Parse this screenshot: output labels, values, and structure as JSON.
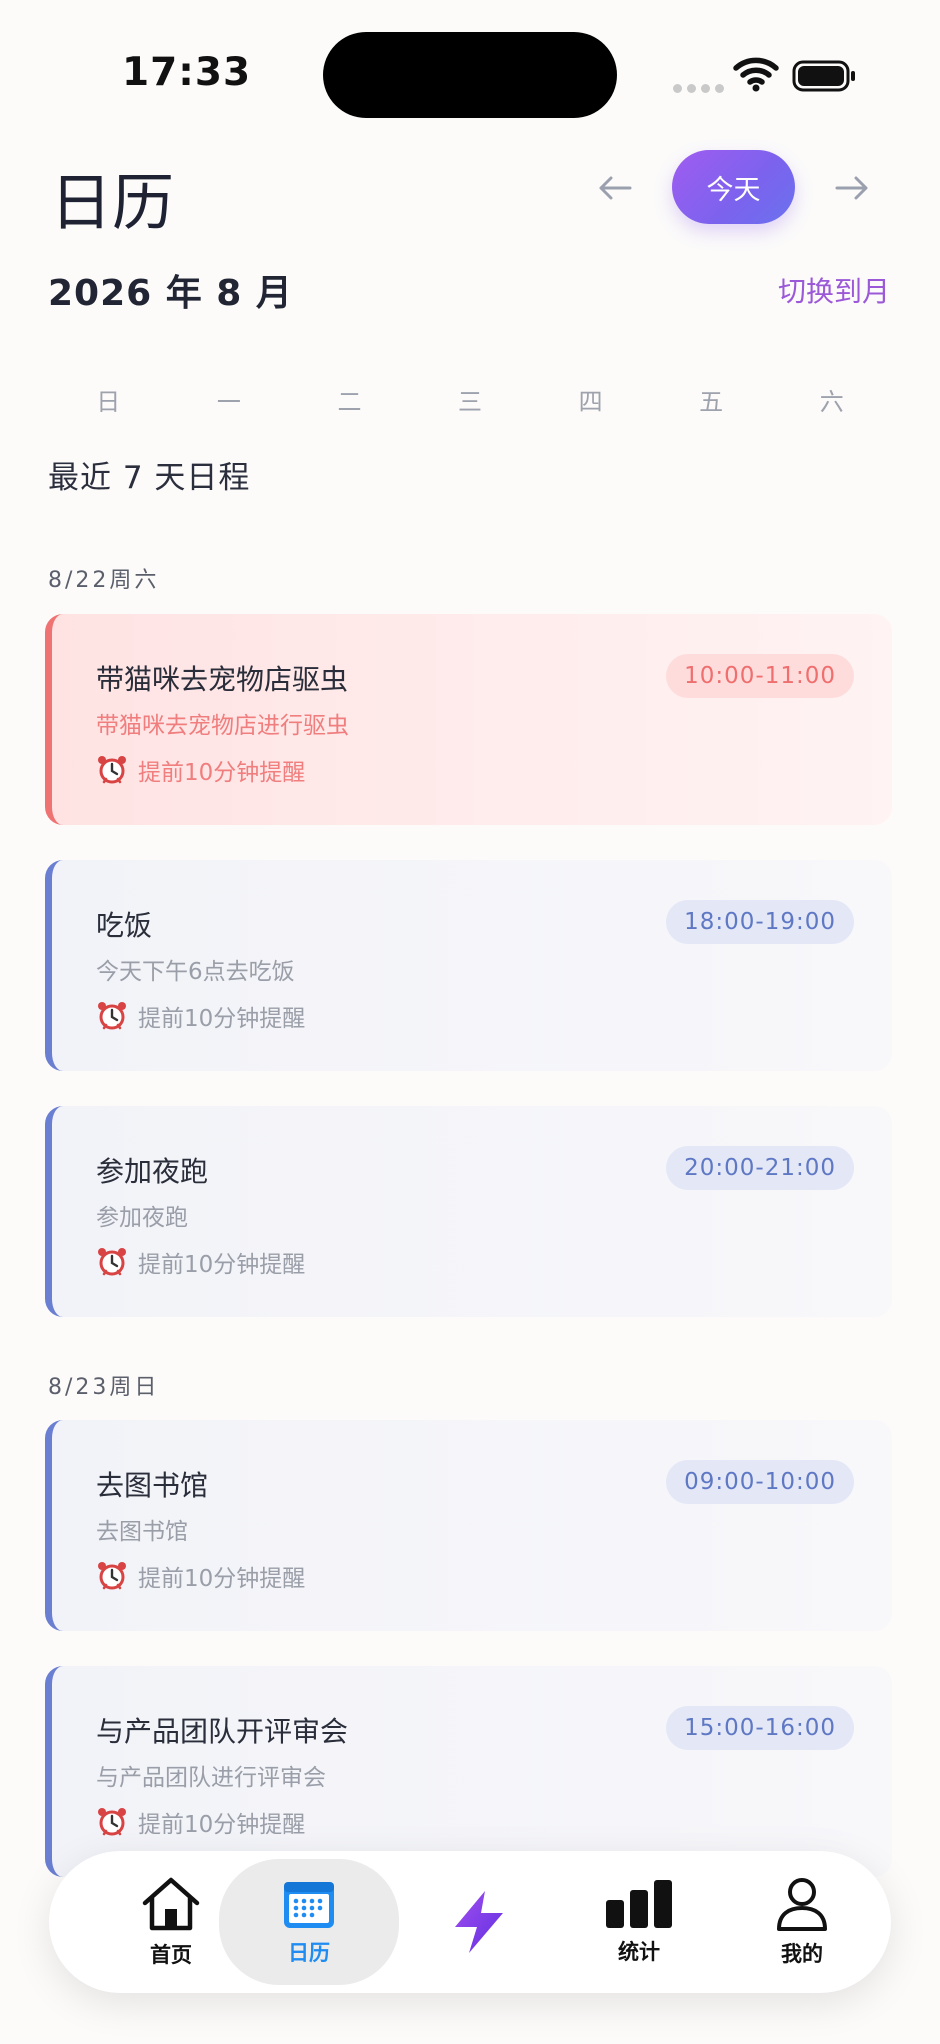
{
  "status_bar": {
    "time": "17:33"
  },
  "header": {
    "title": "日历",
    "today_label": "今天",
    "month_label": "2026 年 8 月",
    "switch_label": "切换到月"
  },
  "weekdays": [
    "日",
    "一",
    "二",
    "三",
    "四",
    "五",
    "六"
  ],
  "section_title": "最近 7 天日程",
  "days": [
    {
      "label": "8/22周六",
      "events": [
        {
          "title": "带猫咪去宠物店驱虫",
          "desc": "带猫咪去宠物店进行驱虫",
          "reminder": "提前10分钟提醒",
          "time": "10:00-11:00",
          "variant": "urgent"
        },
        {
          "title": "吃饭",
          "desc": "今天下午6点去吃饭",
          "reminder": "提前10分钟提醒",
          "time": "18:00-19:00",
          "variant": "normal"
        },
        {
          "title": "参加夜跑",
          "desc": "参加夜跑",
          "reminder": "提前10分钟提醒",
          "time": "20:00-21:00",
          "variant": "normal"
        }
      ]
    },
    {
      "label": "8/23周日",
      "events": [
        {
          "title": "去图书馆",
          "desc": "去图书馆",
          "reminder": "提前10分钟提醒",
          "time": "09:00-10:00",
          "variant": "normal"
        },
        {
          "title": "与产品团队开评审会",
          "desc": "与产品团队进行评审会",
          "reminder": "提前10分钟提醒",
          "time": "15:00-16:00",
          "variant": "normal"
        }
      ]
    }
  ],
  "tab_bar": {
    "tabs": [
      {
        "label": "首页",
        "icon": "home-icon"
      },
      {
        "label": "日历",
        "icon": "calendar-icon",
        "active": true
      },
      {
        "label": "",
        "icon": "lightning-icon"
      },
      {
        "label": "统计",
        "icon": "bar-chart-icon"
      },
      {
        "label": "我的",
        "icon": "user-icon"
      }
    ]
  },
  "colors": {
    "accent": "#9b59d8",
    "urgent": "#ef7373",
    "normal": "#6b7fd2",
    "active_tab": "#1e8cf0"
  }
}
